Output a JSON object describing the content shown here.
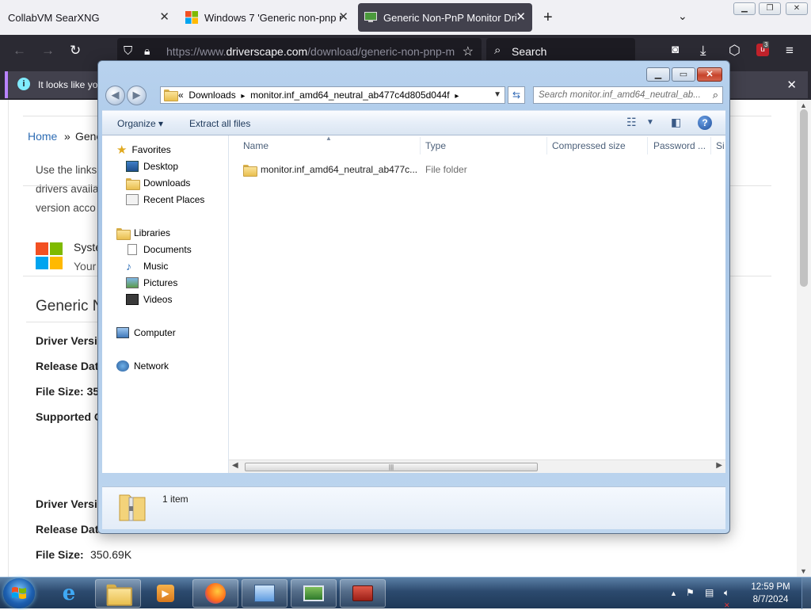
{
  "firefox": {
    "tabs": [
      {
        "label": "CollabVM SearXNG",
        "active": false
      },
      {
        "label": "Windows 7 'Generic non-pnp m",
        "active": false
      },
      {
        "label": "Generic Non-PnP Monitor Drive",
        "active": true
      }
    ],
    "url_prefix": "https://www.",
    "url_domain": "driverscape.com",
    "url_path": "/download/generic-non-pnp-m",
    "search_placeholder": "Search",
    "extension_badge": "3",
    "notification_text": "It looks like yo"
  },
  "webpage": {
    "breadcrumb_home": "Home",
    "breadcrumb_sep": "»",
    "breadcrumb_current": "Gene",
    "intro_lines": [
      "Use the links",
      "drivers availa",
      "version acco"
    ],
    "system_title": "Syste",
    "system_sub": "Your",
    "section_title": "Generic N",
    "fields_a": [
      "Driver Versio",
      "Release Date",
      "File Size: 35",
      "Supported O"
    ],
    "fields_b": [
      "Driver Versio",
      "Release Date"
    ],
    "file_size_label": "File Size:",
    "file_size_value": "350.69K"
  },
  "explorer": {
    "address_crumbs": [
      "«",
      "Downloads",
      "▸",
      "monitor.inf_amd64_neutral_ab477c4d805d044f",
      "▸"
    ],
    "search_placeholder": "Search monitor.inf_amd64_neutral_ab...",
    "toolbar": {
      "organize": "Organize",
      "extract": "Extract all files"
    },
    "nav": {
      "favorites": "Favorites",
      "desktop": "Desktop",
      "downloads": "Downloads",
      "recent": "Recent Places",
      "libraries": "Libraries",
      "documents": "Documents",
      "music": "Music",
      "pictures": "Pictures",
      "videos": "Videos",
      "computer": "Computer",
      "network": "Network"
    },
    "columns": [
      "Name",
      "Type",
      "Compressed size",
      "Password ...",
      "Si"
    ],
    "rows": [
      {
        "name": "monitor.inf_amd64_neutral_ab477c...",
        "type": "File folder"
      }
    ],
    "item_count": "1 item"
  },
  "taskbar": {
    "time": "12:59 PM",
    "date": "8/7/2024"
  }
}
